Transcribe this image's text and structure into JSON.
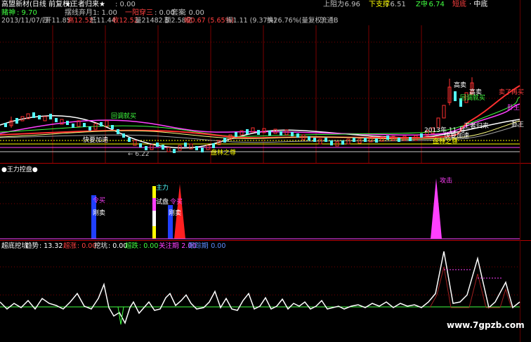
{
  "header": {
    "row1": {
      "title": "高盟新材(日线 前复权)",
      "formula_name": "★王者归来★",
      "value_0": ": 0.00",
      "resistance_label": "上阻力",
      "resistance_value": ": 6.96",
      "support_label": "下支撑",
      "support_value": ": 6.51",
      "zz_label": "Z中",
      "zz_value": ": 6.74",
      "tag1": "短底",
      "tag2": "·  中底"
    },
    "row2": {
      "label_a": "赌神",
      "value_a": ": 9.70",
      "label_b": "摆线弃月1",
      "value_b": ": 1.00",
      "label_c": "一阳穿三",
      "value_c": ": 0.00",
      "label_d": "套案",
      "value_d": ": 0.00"
    },
    "row3": {
      "date": "2013/11/07/四",
      "open": "开11.85",
      "high": "高12.52",
      "low": "低11.44",
      "close": "收12.52",
      "vol": "量21482.5",
      "amount": "额2.58亿",
      "change": "幅0.67 (5.65%)",
      "amp": "振1.11 (9.37%)",
      "turnover": "换26.76%(量复权)",
      "float": "流通B"
    }
  },
  "main_annotations": {
    "huitiao": "回调就买",
    "kuaiji": "快要加速",
    "pan_zhi": "盘林之尊",
    "low_mark": "← 6.22",
    "gaomai": "高卖",
    "zaimai": "高卖",
    "maile": "卖了再买",
    "qijiu": "回调就买",
    "panqin": "盘林之尊",
    "wangzhe": "王者归来",
    "king": "卦王",
    "luxian": "卦王",
    "date_mark": "2013年 11 月",
    "kuaiyaojiasu": "快要加速"
  },
  "panel2": {
    "title": "●王力控盘●",
    "bars": {
      "lingmai1": "令买",
      "zhuli": "主力",
      "shipan": "试盘",
      "lingmai2": "令买",
      "chumai1": "刚卖",
      "chumai2": "刚卖",
      "gongji": "攻击"
    }
  },
  "panel3": {
    "title": "超底挖坑",
    "trend_label": "趋势",
    "trend_value": ": 13.32",
    "super_label": "超涨",
    "super_value": ": 0.00",
    "dig_label": "挖坑",
    "dig_value": ": 0.00",
    "super_bottom_label": "超跌",
    "super_bottom_value": ": 0.00",
    "focus_label": "关注期",
    "focus_value": ": 2.00",
    "track_label": "跟踪期",
    "track_value": ": 0.00"
  },
  "watermark": "www.7gpzb.com",
  "colors": {
    "up": "#ff3030",
    "down": "#54ffff",
    "ma_white": "#ffffff",
    "ma_yellow": "#ffff00",
    "ma_magenta": "#ff40ff",
    "ma_green": "#40ff40",
    "label_green": "#40ff40",
    "label_yellow": "#ffff00",
    "label_red": "#ff4040",
    "label_cyan": "#54ffff",
    "label_blue": "#5b8cff",
    "label_magenta": "#ff40ff",
    "divider": "#d00000"
  }
}
